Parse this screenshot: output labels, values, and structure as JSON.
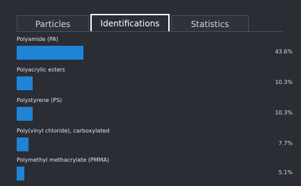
{
  "tabs": [
    {
      "label": "Particles",
      "active": false
    },
    {
      "label": "Identifications",
      "active": true
    },
    {
      "label": "Statistics",
      "active": false
    }
  ],
  "colors": {
    "background": "#2a2d33",
    "bar": "#1f84d6",
    "active_tab_border": "#ffffff"
  },
  "identifications": [
    {
      "name": "Polyamide (PA)",
      "percent_label": "43.6%",
      "percent": 43.6
    },
    {
      "name": "Polyacrylic esters",
      "percent_label": "10.3%",
      "percent": 10.3
    },
    {
      "name": "Polystyrene (PS)",
      "percent_label": "10.3%",
      "percent": 10.3
    },
    {
      "name": "Poly(vinyl chloride), carboxylated",
      "percent_label": "7.7%",
      "percent": 7.7
    },
    {
      "name": "Polymethyl methacrylate (PMMA)",
      "percent_label": "5.1%",
      "percent": 5.1
    }
  ]
}
